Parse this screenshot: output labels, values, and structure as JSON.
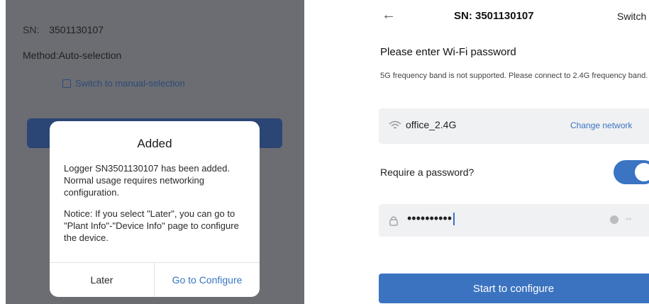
{
  "left": {
    "sn_label": "SN:",
    "sn_value": "3501130107",
    "method": "Method:Auto-selection",
    "switch_manual": "Switch to manual-selection",
    "dialog": {
      "title": "Added",
      "message": "Logger SN3501130107 has been added. Normal usage requires networking configuration.",
      "notice": "Notice: If you select \"Later\", you can go to \"Plant Info\"-\"Device Info\" page to configure the device.",
      "later": "Later",
      "go_configure": "Go to Configure"
    }
  },
  "right": {
    "header": {
      "title": "SN: 3501130107",
      "switch": "Switch"
    },
    "heading": "Please enter Wi-Fi password",
    "note": "5G frequency band is not supported. Please connect to 2.4G frequency band.",
    "network": {
      "name": "office_2.4G",
      "change": "Change network"
    },
    "require_password": "Require a password?",
    "password_toggle_on": true,
    "password_mask": "••••••••••",
    "start": "Start to configure"
  },
  "colors": {
    "accent": "#3a74c2",
    "overlay": "#6b6d72"
  },
  "icons": [
    "back-arrow-icon",
    "wifi-icon",
    "lock-icon",
    "clear-icon",
    "eye-closed-icon",
    "switch-manual-icon"
  ]
}
